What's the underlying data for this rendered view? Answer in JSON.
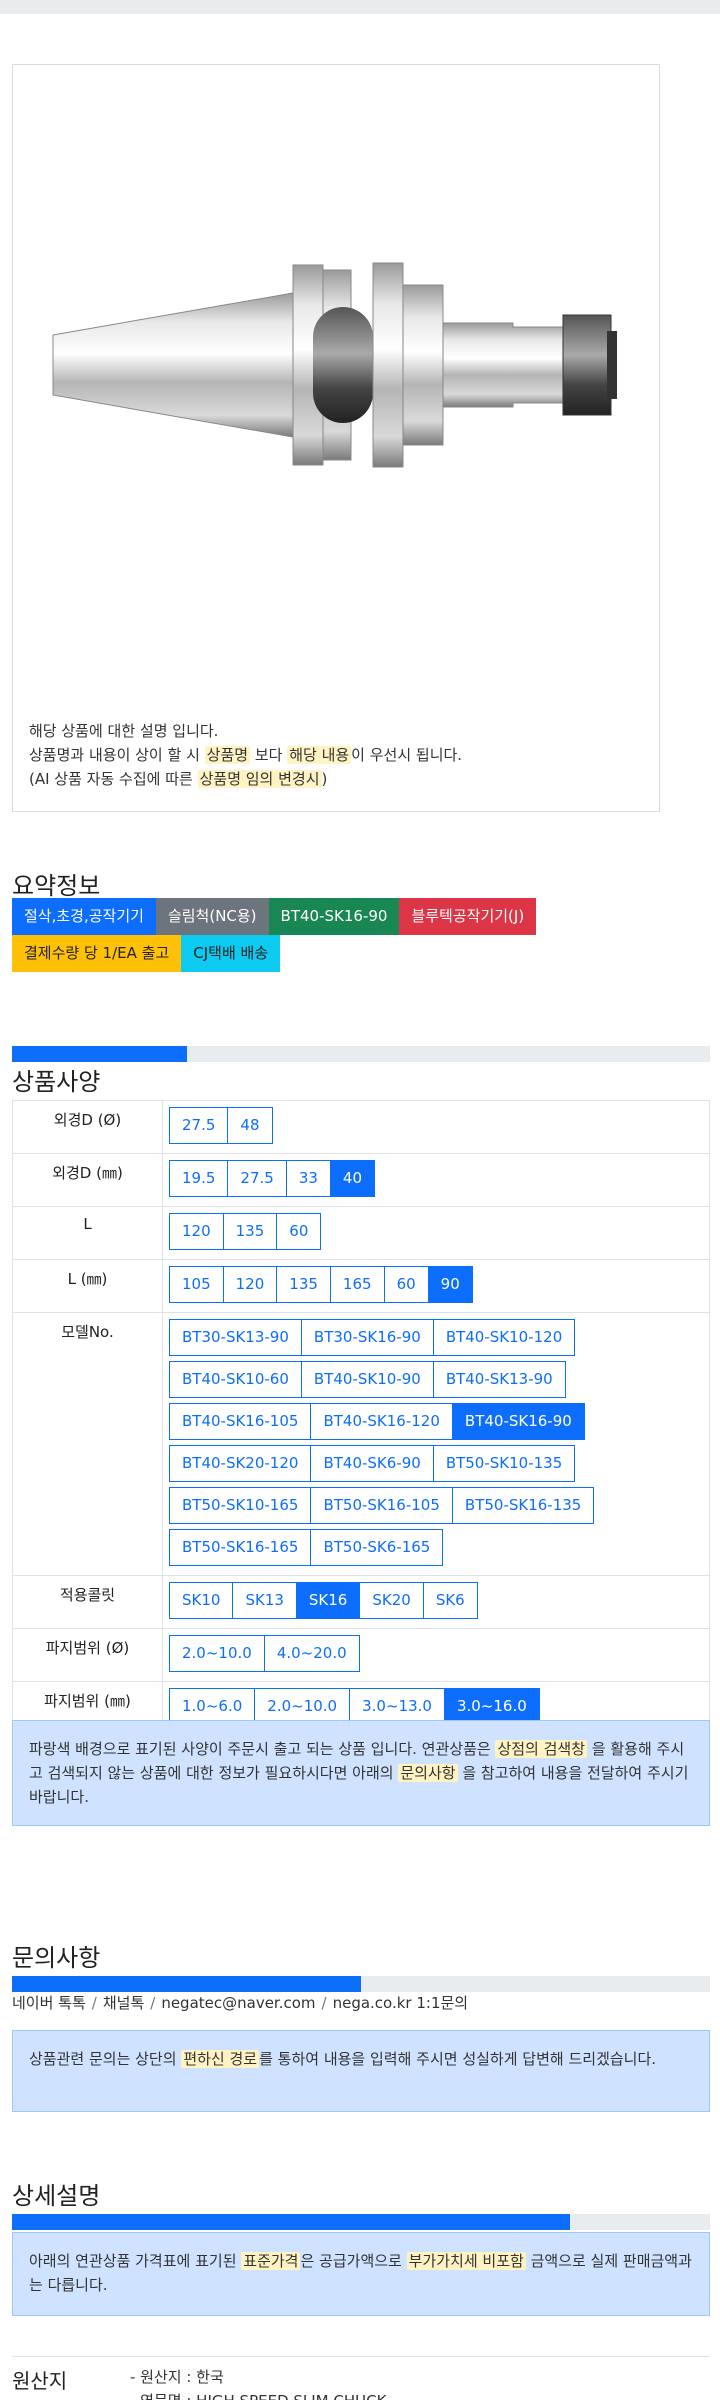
{
  "product": {
    "description_lines": [
      [
        {
          "t": "해당 상품에 대한 설명 입니다."
        }
      ],
      [
        {
          "t": "상품명과 내용이 상이 할 시 "
        },
        {
          "t": "상품명",
          "hl": true
        },
        {
          "t": " 보다 "
        },
        {
          "t": "해당 내용",
          "hl": true
        },
        {
          "t": "이 우선시 됩니다."
        }
      ],
      [
        {
          "t": "(AI 상품 자동 수집에 따른 "
        },
        {
          "t": "상품명 임의 변경시",
          "hl": true
        },
        {
          "t": ")"
        }
      ]
    ]
  },
  "summary": {
    "title": "요약정보",
    "tags_row1": [
      {
        "label": "절삭,초경,공작기기",
        "color": "blue"
      },
      {
        "label": "슬림척(NC용)",
        "color": "gray"
      },
      {
        "label": "BT40-SK16-90",
        "color": "green"
      },
      {
        "label": "블루텍공작기기(J)",
        "color": "red"
      }
    ],
    "tags_row2": [
      {
        "label": "결제수량 당 1/EA 출고",
        "color": "yellow"
      },
      {
        "label": "CJ택배 배송",
        "color": "cyan"
      }
    ]
  },
  "specs": {
    "title": "상품사양",
    "progress": 0.25,
    "rows": [
      {
        "label": "외경D (Ø)",
        "options": [
          "27.5",
          "48"
        ],
        "active": []
      },
      {
        "label": "외경D (㎜)",
        "options": [
          "19.5",
          "27.5",
          "33",
          "40"
        ],
        "active": [
          "40"
        ]
      },
      {
        "label": "L",
        "options": [
          "120",
          "135",
          "60"
        ],
        "active": []
      },
      {
        "label": "L (㎜)",
        "options": [
          "105",
          "120",
          "135",
          "165",
          "60",
          "90"
        ],
        "active": [
          "90"
        ]
      },
      {
        "label": "모델No.",
        "options": [
          "BT30-SK13-90",
          "BT30-SK16-90",
          "BT40-SK10-120",
          "BT40-SK10-60",
          "BT40-SK10-90",
          "BT40-SK13-90",
          "BT40-SK16-105",
          "BT40-SK16-120",
          "BT40-SK16-90",
          "BT40-SK20-120",
          "BT40-SK6-90",
          "BT50-SK10-135",
          "BT50-SK10-165",
          "BT50-SK16-105",
          "BT50-SK16-135",
          "BT50-SK16-165",
          "BT50-SK6-165"
        ],
        "active": [
          "BT40-SK16-90"
        ]
      },
      {
        "label": "적용콜릿",
        "options": [
          "SK10",
          "SK13",
          "SK16",
          "SK20",
          "SK6"
        ],
        "active": [
          "SK16"
        ]
      },
      {
        "label": "파지범위 (Ø)",
        "options": [
          "2.0~10.0",
          "4.0~20.0"
        ],
        "active": []
      },
      {
        "label": "파지범위 (㎜)",
        "options": [
          "1.0~6.0",
          "2.0~10.0",
          "3.0~13.0",
          "3.0~16.0"
        ],
        "active": [
          "3.0~16.0"
        ]
      }
    ],
    "notice": [
      {
        "t": "파랑색 배경으로 표기된 사양이 주문시 출고 되는 상품 입니다. 연관상품은 "
      },
      {
        "t": "상점의 검색창",
        "hl": true
      },
      {
        "t": " 을 활용해 주시고 검색되지 않는 상품에 대한 정보가 필요하시다면 아래의 "
      },
      {
        "t": "문의사항",
        "hl": true
      },
      {
        "t": " 을 참고하여 내용을 전달하여 주시기 바랍니다."
      }
    ]
  },
  "inquiry": {
    "title": "문의사항",
    "progress": 0.5,
    "contacts": [
      "네이버 톡톡",
      "채널톡",
      "negatec@naver.com",
      "nega.co.kr 1:1문의"
    ],
    "notice": [
      {
        "t": "상품관련 문의는 상단의 "
      },
      {
        "t": "편하신 경로",
        "hl": true
      },
      {
        "t": "를 통하여 내용을 입력해 주시면 성실하게 답변해 드리겠습니다."
      }
    ]
  },
  "detail": {
    "title": "상세설명",
    "progress": 0.8,
    "notice": [
      {
        "t": "아래의 연관상품 가격표에 표기된 "
      },
      {
        "t": "표준가격",
        "hl": true
      },
      {
        "t": "은 공급가액으로 "
      },
      {
        "t": "부가가치세 비포함",
        "hl": true
      },
      {
        "t": " 금액으로 실제 판매금액과는 다릅니다."
      }
    ]
  },
  "origin": {
    "label": "원산지",
    "items": [
      "- 원산지 : 한국",
      "- 영문명 : HIGH SPEED SLIM CHUCK"
    ]
  }
}
